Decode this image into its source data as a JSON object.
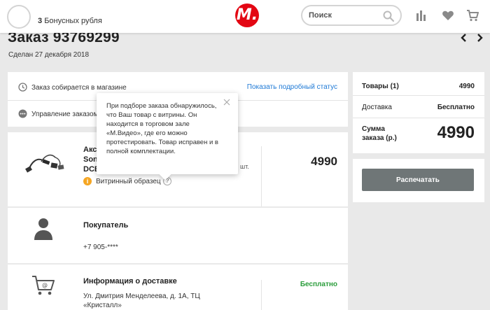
{
  "header": {
    "bonus_count": "3",
    "bonus_label": "Бонусных рубля",
    "logo_text": "М.",
    "search_placeholder": "Поиск"
  },
  "order": {
    "title": "Заказ 93769299",
    "made_date": "Сделан 27 декабря 2018"
  },
  "status": {
    "text": "Заказ собирается в магазине",
    "link": "Показать подробный статус",
    "manage": "Управление заказом"
  },
  "item": {
    "name_lines": [
      "Акс",
      "Son",
      "DCB"
    ],
    "qty": "шт.",
    "price": "4990",
    "badge": "i",
    "badge_label": "Витринный образец",
    "help": "?"
  },
  "buyer": {
    "title": "Покупатель",
    "phone": "+7 905-****"
  },
  "delivery": {
    "title": "Информация о доставке",
    "address_line1": "Ул. Дмитрия Менделеева, д. 1А, ТЦ",
    "address_line2": "«Кристалл»",
    "price": "Бесплатно"
  },
  "summary": {
    "items_label": "Товары (1)",
    "items_value": "4990",
    "delivery_label": "Доставка",
    "delivery_value": "Бесплатно",
    "total_label_1": "Сумма",
    "total_label_2": "заказа (р.)",
    "total_value": "4990",
    "print_button": "Распечатать"
  },
  "tooltip": {
    "text": "При подборе заказа обнаружилось, что Ваш товар с витрины. Он находится в торговом зале «М.Видео», где его можно протестировать. Товар исправен и в полной комплектации."
  },
  "colors": {
    "brand_red": "#e30613",
    "link_blue": "#1f7ad6",
    "free_green": "#2a9d3b",
    "warning_orange": "#f5a623",
    "button_gray": "#6f7677"
  }
}
